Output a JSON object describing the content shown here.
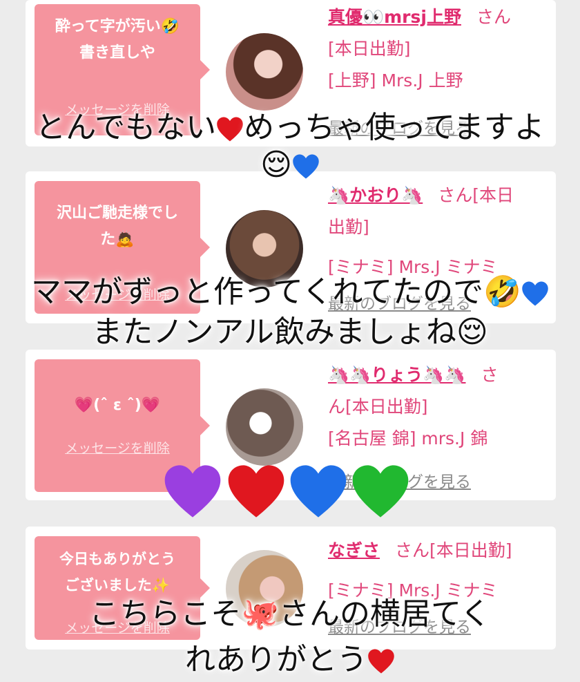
{
  "messages": [
    {
      "bubble_text": "酔って字が汚い🤣\n書き直しや",
      "delete_label": "メッセージを削除",
      "name": "真優👀mrsj上野",
      "honorific": "さん",
      "status": "[本日出勤]",
      "shop": "[上野] Mrs.J 上野",
      "blog_link": "最新のブログを見る"
    },
    {
      "bubble_text": "沢山ご馳走様でし\nた🙇",
      "delete_label": "メッセージを削除",
      "name": "🦄かおり🦄",
      "honorific": "さん[本日",
      "status": "出勤]",
      "shop": "[ミナミ] Mrs.J ミナミ",
      "blog_link": "最新のブログを見る"
    },
    {
      "bubble_text": "💗(ˆ ε ˆ)💗",
      "delete_label": "メッセージを削除",
      "name": "🦄🦄りょう🦄🦄",
      "honorific": "さ",
      "status": "ん[本日出勤]",
      "shop": "[名古屋 錦] mrs.J 錦",
      "blog_link": "最新のブログを見る"
    },
    {
      "bubble_text": "今日もありがとう\nございました✨",
      "delete_label": "メッセージを削除",
      "name": "なぎさ",
      "honorific": "さん[本日出勤]",
      "status": "",
      "shop": "[ミナミ] Mrs.J ミナミ",
      "blog_link": "最新のブログを見る"
    }
  ],
  "overlays": {
    "line1": "とんでもない",
    "line1b": "めっちゃ使ってますよ",
    "line1c": "😌",
    "line2": "ママがずっと作ってくれてたので🤣",
    "line2b": "またノンアル飲みましょね😌",
    "line3": "こちらこそ🐙さんの横居てく",
    "line3b": "れありがとう"
  },
  "colors": {
    "bubble": "#f5949e",
    "name": "#e02b6e",
    "heart_purple": "#9a3fe0",
    "heart_red": "#e0171f",
    "heart_blue": "#1f6fe8",
    "heart_green": "#21b830"
  }
}
